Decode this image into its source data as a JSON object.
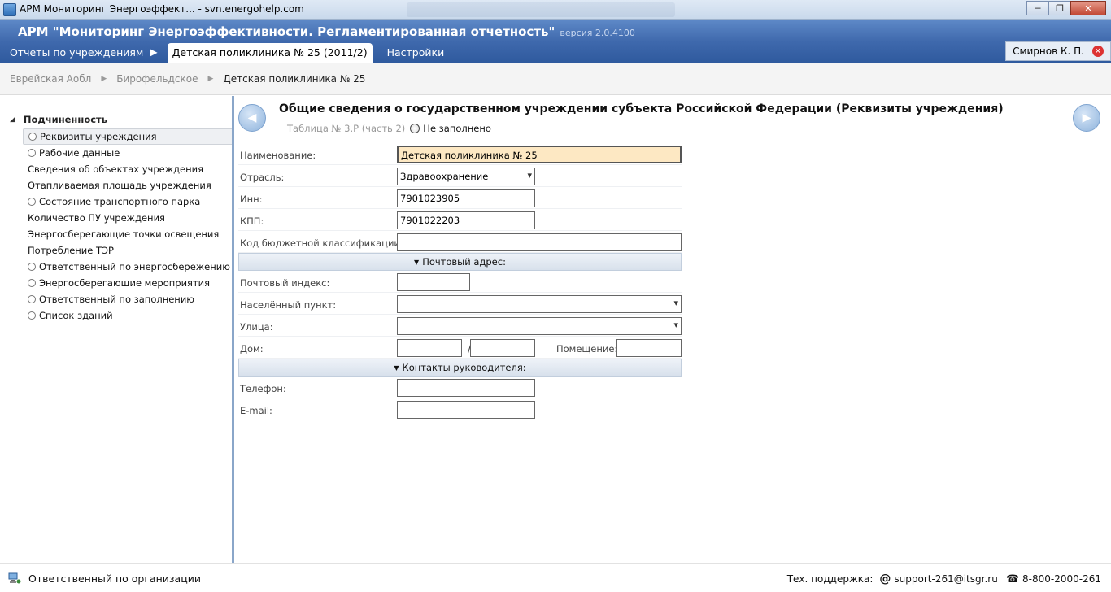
{
  "window": {
    "title": "АРМ Мониторинг Энергоэффект... - svn.energohelp.com",
    "minimize": "─",
    "maximize": "❐",
    "close": "✕"
  },
  "header": {
    "app_title": "АРМ \"Мониторинг Энергоэффективности. Регламентированная отчетность\"",
    "version": "версия 2.0.4100",
    "tabs": [
      {
        "label": "Отчеты по учреждениям"
      },
      {
        "label": "Детская поликлиника № 25 (2011/2)"
      },
      {
        "label": "Настройки"
      }
    ],
    "user": "Смирнов К. П."
  },
  "breadcrumb": {
    "items": [
      "Еврейская Аобл",
      "Бирофельдское",
      "Детская поликлиника № 25"
    ]
  },
  "sidebar": {
    "root": "Подчиненность",
    "items": [
      {
        "label": "Реквизиты учреждения",
        "radio": true,
        "selected": true
      },
      {
        "label": "Рабочие данные",
        "radio": true
      },
      {
        "label": "Сведения об объектах учреждения",
        "radio": false
      },
      {
        "label": "Отапливаемая площадь учреждения",
        "radio": false
      },
      {
        "label": "Состояние транспортного парка",
        "radio": true
      },
      {
        "label": "Количество ПУ учреждения",
        "radio": false
      },
      {
        "label": "Энергосберегающие точки освещения",
        "radio": false
      },
      {
        "label": "Потребление ТЭР",
        "radio": false
      },
      {
        "label": "Ответственный по энергосбережению",
        "radio": true
      },
      {
        "label": "Энергосберегающие мероприятия",
        "radio": true
      },
      {
        "label": "Ответственный по заполнению",
        "radio": true
      },
      {
        "label": "Список зданий",
        "radio": true
      }
    ]
  },
  "main": {
    "title": "Общие сведения о государственном учреждении субъекта Российской Федерации (Реквизиты учреждения)",
    "table_ref": "Таблица № 3.Р (часть 2)",
    "status": "Не заполнено",
    "form": {
      "name_label": "Наименование:",
      "name_value": "Детская поликлиника № 25",
      "industry_label": "Отрасль:",
      "industry_value": "Здравоохранение",
      "inn_label": "Инн:",
      "inn_value": "7901023905",
      "kpp_label": "КПП:",
      "kpp_value": "7901022203",
      "budget_label": "Код бюджетной классификации:",
      "budget_value": "",
      "postal_section": "Почтовый адрес:",
      "zip_label": "Почтовый индекс:",
      "zip_value": "",
      "locality_label": "Населённый пункт:",
      "locality_value": "",
      "street_label": "Улица:",
      "street_value": "",
      "house_label": "Дом:",
      "house_value": "",
      "building_value": "",
      "room_label": "Помещение:",
      "room_value": "",
      "contacts_section": "Контакты руководителя:",
      "phone_label": "Телефон:",
      "phone_value": "",
      "email_label": "E-mail:",
      "email_value": ""
    }
  },
  "statusbar": {
    "responsible": "Ответственный по организации",
    "support_label": "Тех. поддержка:",
    "support_email": "support-261@itsgr.ru",
    "support_phone": "8-800-2000-261"
  },
  "colors": {
    "header_bg": "#3f69ad",
    "highlight_field": "#fde8c3",
    "splitter": "#8aa6c9"
  }
}
